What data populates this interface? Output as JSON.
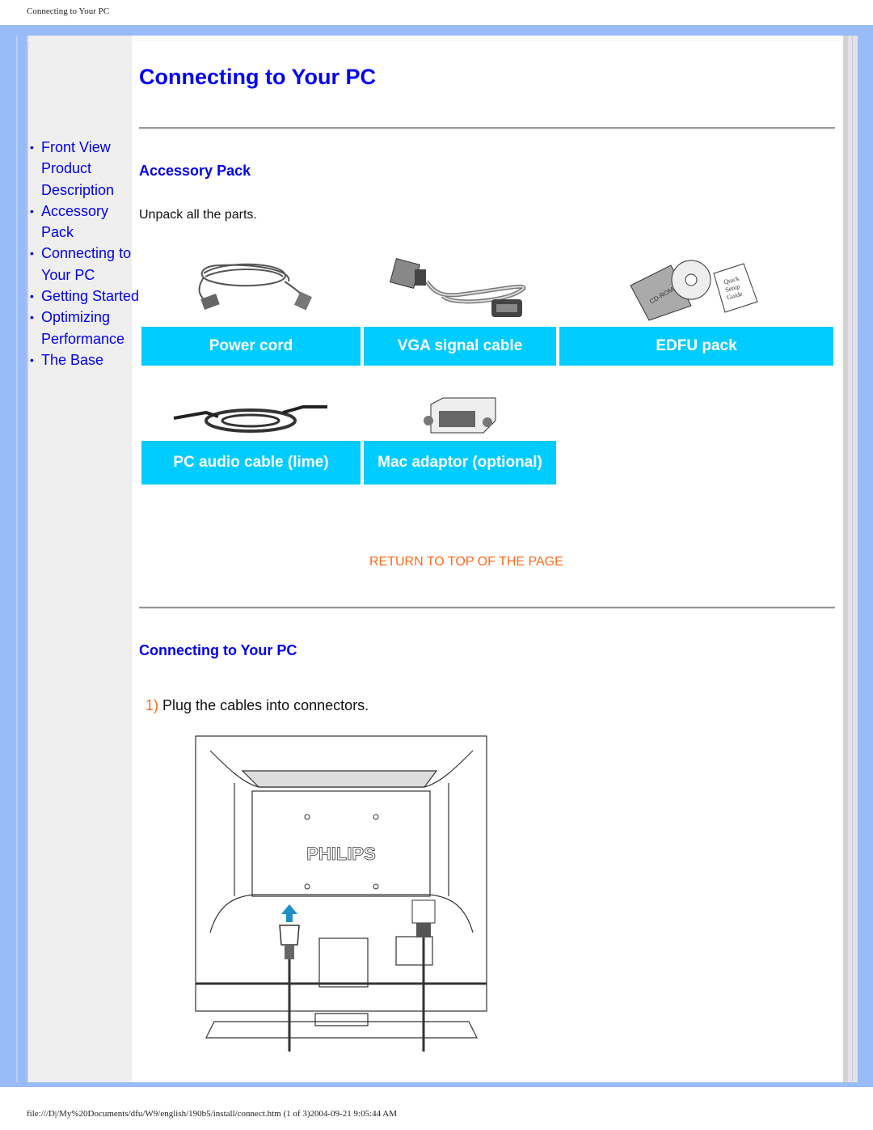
{
  "print_header": "Connecting to Your PC",
  "print_footer": "file:///D|/My%20Documents/dfu/W9/english/190b5/install/connect.htm (1 of 3)2004-09-21 9:05:44 AM",
  "sidebar": {
    "items": [
      {
        "label": "Front View Product Description"
      },
      {
        "label": "Accessory Pack"
      },
      {
        "label": "Connecting to Your PC"
      },
      {
        "label": "Getting Started"
      },
      {
        "label": "Optimizing Performance"
      },
      {
        "label": "The Base"
      }
    ]
  },
  "main": {
    "title": "Connecting to Your PC",
    "accessory_section": {
      "heading": "Accessory Pack",
      "intro": "Unpack all the parts.",
      "items": [
        {
          "label": "Power cord",
          "icon": "power-cord-image"
        },
        {
          "label": "VGA signal cable",
          "icon": "vga-cable-image"
        },
        {
          "label": "EDFU pack",
          "icon": "edfu-pack-image"
        },
        {
          "label": "PC audio cable (lime)",
          "icon": "audio-cable-image"
        },
        {
          "label": "Mac adaptor (optional)",
          "icon": "mac-adaptor-image"
        }
      ],
      "edfu_cd_text": "CD-ROM",
      "edfu_guide_text": "Quick Setup Guide"
    },
    "return_link": "RETURN TO TOP OF THE PAGE",
    "connect_section": {
      "heading": "Connecting to Your PC",
      "steps": [
        {
          "number": "1)",
          "text": "Plug the cables into connectors."
        }
      ],
      "diagram_brand": "PHILIPS"
    }
  },
  "colors": {
    "link": "#0000ee",
    "accent_orange": "#ff6a1a",
    "label_bg": "#00ccff",
    "frame": "#99bbf7"
  }
}
